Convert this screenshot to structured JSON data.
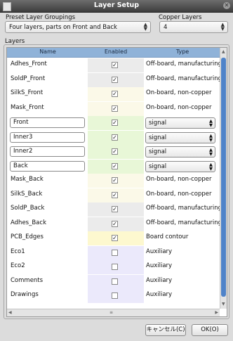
{
  "window": {
    "title": "Layer Setup"
  },
  "preset": {
    "label": "Preset Layer Groupings",
    "value": "Four layers, parts on Front and Back"
  },
  "copper": {
    "label": "Copper Layers",
    "value": "4"
  },
  "layers_group": {
    "label": "Layers"
  },
  "columns": {
    "name": "Name",
    "enabled": "Enabled",
    "type": "Type"
  },
  "colors": {
    "header": "#8fb2d8",
    "technical": "#fbf9e8",
    "copper": "#e8f7d7",
    "sold_adhes": "#ebebeb",
    "edge": "#fdf8cf",
    "auxiliary": "#ebe9fb",
    "scroll_thumb": "#4f83c9"
  },
  "layers": [
    {
      "name": "Adhes_Front",
      "enabled": true,
      "type": "Off-board, manufacturing",
      "editable": false,
      "group": "sold_adhes"
    },
    {
      "name": "SoldP_Front",
      "enabled": true,
      "type": "Off-board, manufacturing",
      "editable": false,
      "group": "sold_adhes"
    },
    {
      "name": "SilkS_Front",
      "enabled": true,
      "type": "On-board, non-copper",
      "editable": false,
      "group": "technical"
    },
    {
      "name": "Mask_Front",
      "enabled": true,
      "type": "On-board, non-copper",
      "editable": false,
      "group": "technical"
    },
    {
      "name": "Front",
      "enabled": true,
      "type": "signal",
      "editable": true,
      "group": "copper"
    },
    {
      "name": "Inner3",
      "enabled": true,
      "type": "signal",
      "editable": true,
      "group": "copper"
    },
    {
      "name": "Inner2",
      "enabled": true,
      "type": "signal",
      "editable": true,
      "group": "copper"
    },
    {
      "name": "Back",
      "enabled": true,
      "type": "signal",
      "editable": true,
      "group": "copper"
    },
    {
      "name": "Mask_Back",
      "enabled": true,
      "type": "On-board, non-copper",
      "editable": false,
      "group": "technical"
    },
    {
      "name": "SilkS_Back",
      "enabled": true,
      "type": "On-board, non-copper",
      "editable": false,
      "group": "technical"
    },
    {
      "name": "SoldP_Back",
      "enabled": true,
      "type": "Off-board, manufacturing",
      "editable": false,
      "group": "sold_adhes"
    },
    {
      "name": "Adhes_Back",
      "enabled": true,
      "type": "Off-board, manufacturing",
      "editable": false,
      "group": "sold_adhes"
    },
    {
      "name": "PCB_Edges",
      "enabled": true,
      "type": "Board contour",
      "editable": false,
      "group": "edge"
    },
    {
      "name": "Eco1",
      "enabled": false,
      "type": "Auxiliary",
      "editable": false,
      "group": "auxiliary"
    },
    {
      "name": "Eco2",
      "enabled": false,
      "type": "Auxiliary",
      "editable": false,
      "group": "auxiliary"
    },
    {
      "name": "Comments",
      "enabled": false,
      "type": "Auxiliary",
      "editable": false,
      "group": "auxiliary"
    },
    {
      "name": "Drawings",
      "enabled": false,
      "type": "Auxiliary",
      "editable": false,
      "group": "auxiliary"
    }
  ],
  "buttons": {
    "cancel": "キャンセル(C)",
    "ok": "OK(O)"
  }
}
